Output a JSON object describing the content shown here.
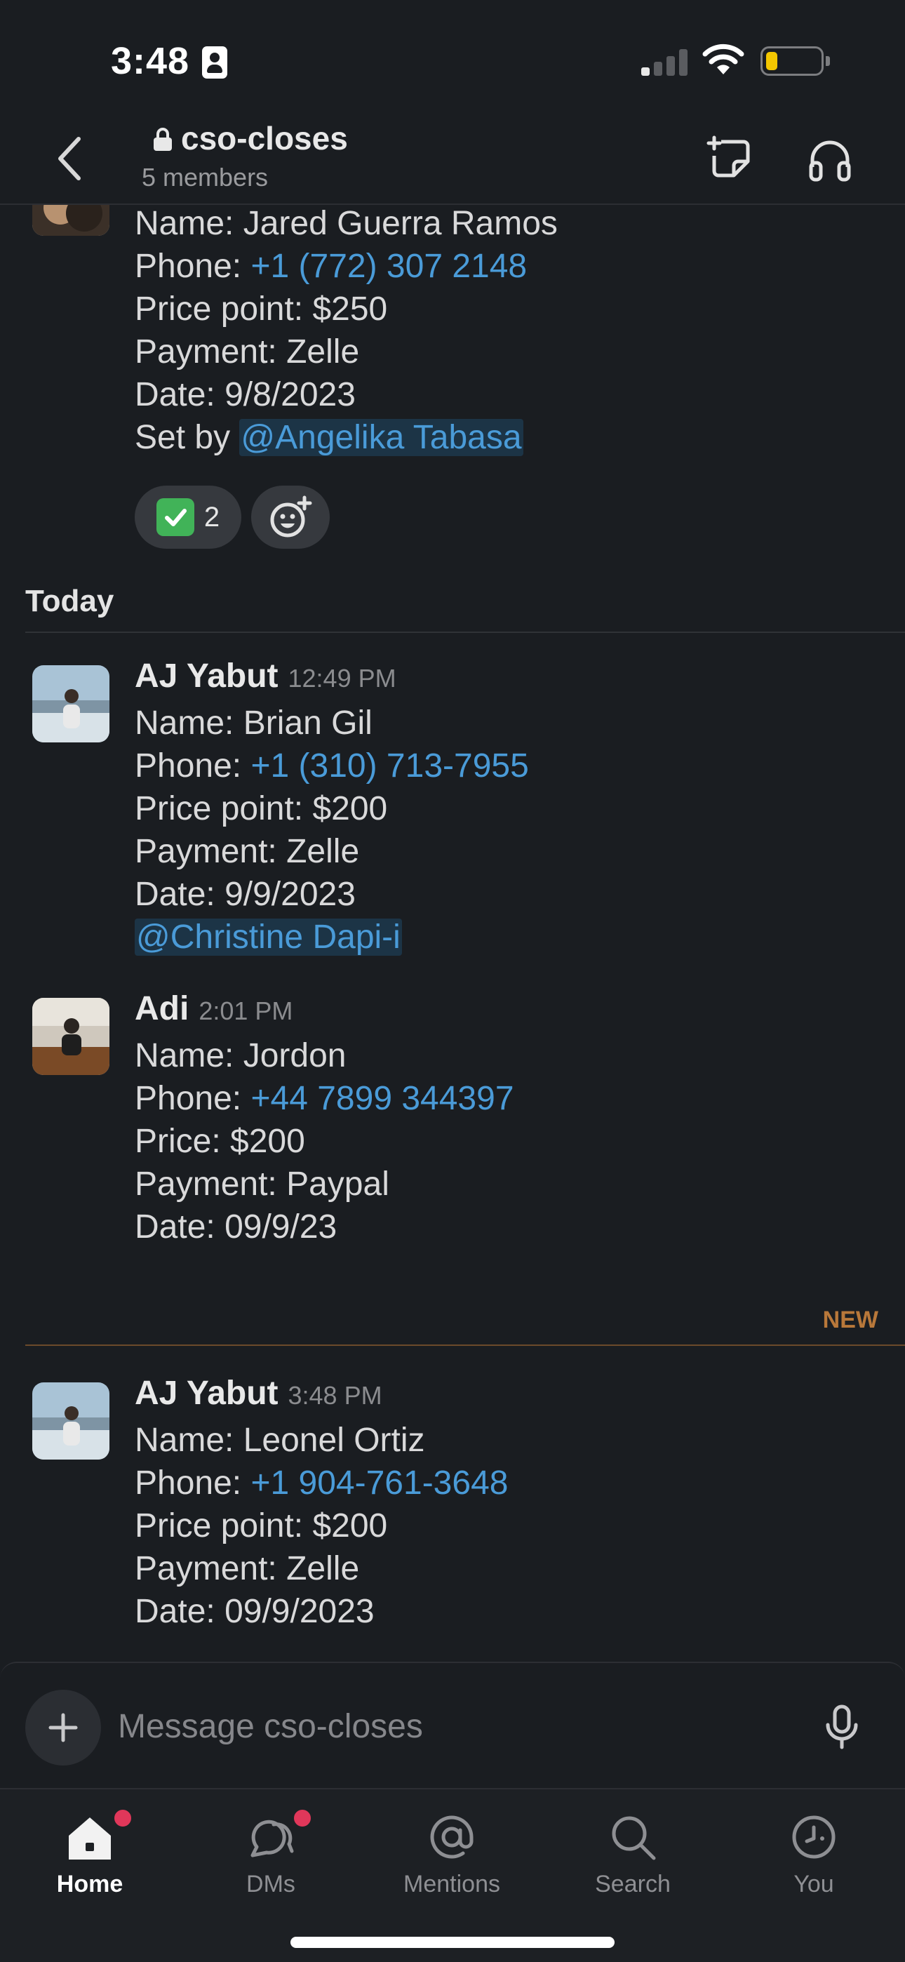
{
  "status_bar": {
    "time": "3:48"
  },
  "header": {
    "channel_name": "cso-closes",
    "members": "5 members"
  },
  "messages": [
    {
      "lines": {
        "name": "Name: Jared Guerra Ramos",
        "phone_prefix": "Phone: ",
        "phone": "+1 (772) 307 2148",
        "price": "Price point: $250",
        "payment": "Payment: Zelle",
        "date": "Date: 9/8/2023",
        "set_by_prefix": "Set by ",
        "mention": "@Angelika Tabasa"
      },
      "reactions": {
        "check_count": "2"
      }
    },
    {
      "author": "AJ Yabut",
      "time": "12:49 PM",
      "lines": {
        "name": "Name: Brian Gil",
        "phone_prefix": "Phone: ",
        "phone": "+1 (310) 713-7955",
        "price": "Price point: $200",
        "payment": "Payment: Zelle",
        "date": "Date: 9/9/2023",
        "mention": "@Christine Dapi-i"
      }
    },
    {
      "author": "Adi",
      "time": "2:01 PM",
      "lines": {
        "name": "Name: Jordon",
        "phone_prefix": "Phone: ",
        "phone": "+44 7899 344397",
        "price": "Price: $200",
        "payment": "Payment: Paypal",
        "date": "Date: 09/9/23"
      }
    },
    {
      "author": "AJ Yabut",
      "time": "3:48 PM",
      "lines": {
        "name": "Name: Leonel Ortiz",
        "phone_prefix": "Phone: ",
        "phone": "+1 904-761-3648",
        "price": "Price point: $200",
        "payment": "Payment: Zelle",
        "date": "Date: 09/9/2023"
      }
    }
  ],
  "dividers": {
    "day": "Today",
    "new": "NEW"
  },
  "composer": {
    "placeholder": "Message cso-closes"
  },
  "tabs": [
    {
      "label": "Home",
      "icon": "home-icon",
      "badge": true
    },
    {
      "label": "DMs",
      "icon": "dms-icon",
      "badge": true
    },
    {
      "label": "Mentions",
      "icon": "at-icon",
      "badge": false
    },
    {
      "label": "Search",
      "icon": "search-icon",
      "badge": false
    },
    {
      "label": "You",
      "icon": "you-icon",
      "badge": false
    }
  ],
  "colors": {
    "background": "#1a1d21",
    "link": "#4a9bd8",
    "new_divider": "#b8783a",
    "badge": "#e0375a",
    "reaction_check": "#41b358"
  }
}
